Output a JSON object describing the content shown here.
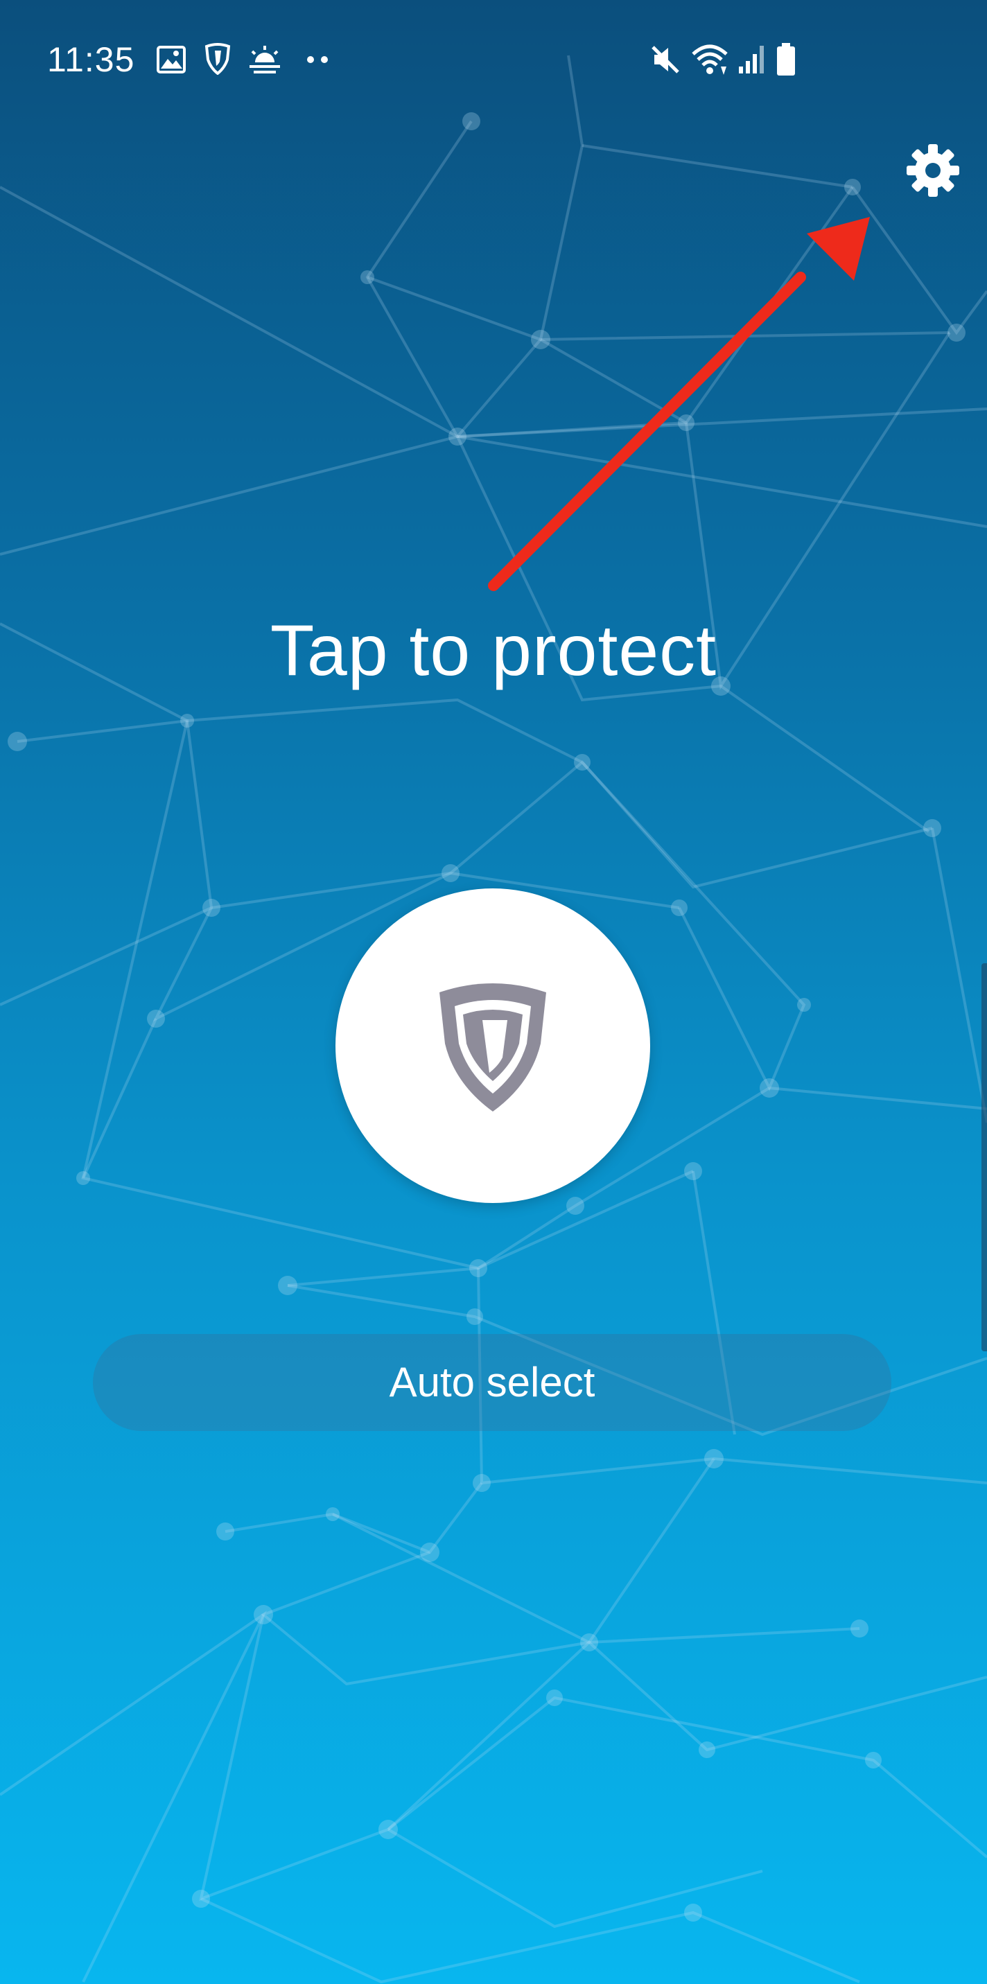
{
  "status_bar": {
    "time": "11:35",
    "left_icons": [
      "gallery-icon",
      "shield-notification-icon",
      "weather-icon",
      "more-notifications-icon"
    ],
    "right_icons": [
      "mute-icon",
      "wifi-icon",
      "signal-icon",
      "battery-icon"
    ]
  },
  "header": {
    "settings_icon": "gear-icon"
  },
  "main": {
    "headline": "Tap to protect",
    "connect_icon": "shield-icon",
    "server_select_label": "Auto select"
  },
  "colors": {
    "background_top": "#0b4f7d",
    "background_bottom": "#08b6ef",
    "annotation_arrow": "#ee2a1b",
    "shield_gray": "#8e8c9a",
    "button_white": "#ffffff"
  }
}
